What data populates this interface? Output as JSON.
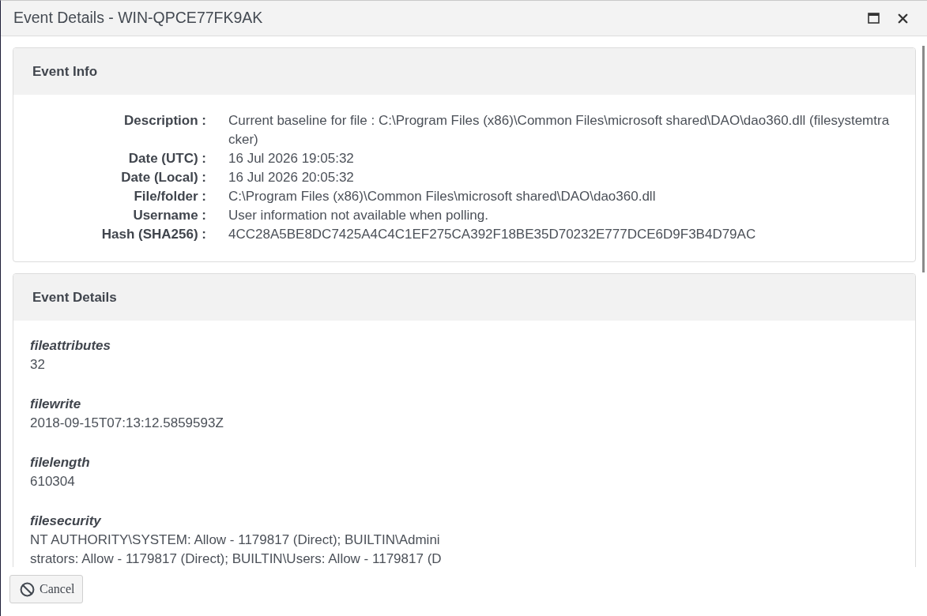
{
  "window": {
    "title": "Event Details - WIN-QPCE77FK9AK"
  },
  "panels": [
    {
      "kind": "properties",
      "title": "Event Info",
      "rows": [
        {
          "label": "Description :",
          "value": "Current baseline for file : C:\\Program Files (x86)\\Common Files\\microsoft shared\\DAO\\dao360.dll (filesystemtracker)"
        },
        {
          "label": "Date (UTC) :",
          "value": "16 Jul 2026 19:05:32"
        },
        {
          "label": "Date (Local) :",
          "value": "16 Jul 2026 20:05:32"
        },
        {
          "label": "File/folder :",
          "value": "C:\\Program Files (x86)\\Common Files\\microsoft shared\\DAO\\dao360.dll"
        },
        {
          "label": "Username :",
          "value": "User information not available when polling."
        },
        {
          "label": "Hash (SHA256) :",
          "value": "4CC28A5BE8DC7425A4C4C1EF275CA392F18BE35D70232E777DCE6D9F3B4D79AC"
        }
      ]
    },
    {
      "kind": "fields",
      "title": "Event Details",
      "fields": [
        {
          "name": "fileattributes",
          "value": "32"
        },
        {
          "name": "filewrite",
          "value": "2018-09-15T07:13:12.5859593Z"
        },
        {
          "name": "filelength",
          "value": "610304"
        },
        {
          "name": "filesecurity",
          "value": "NT AUTHORITY\\SYSTEM: Allow - 1179817 (Direct); BUILTIN\\Administrators: Allow - 1179817 (Direct); BUILTIN\\Users: Allow - 1179817 (D"
        }
      ]
    }
  ],
  "buttons": [
    {
      "kind": "cancel",
      "label": "Cancel"
    }
  ]
}
